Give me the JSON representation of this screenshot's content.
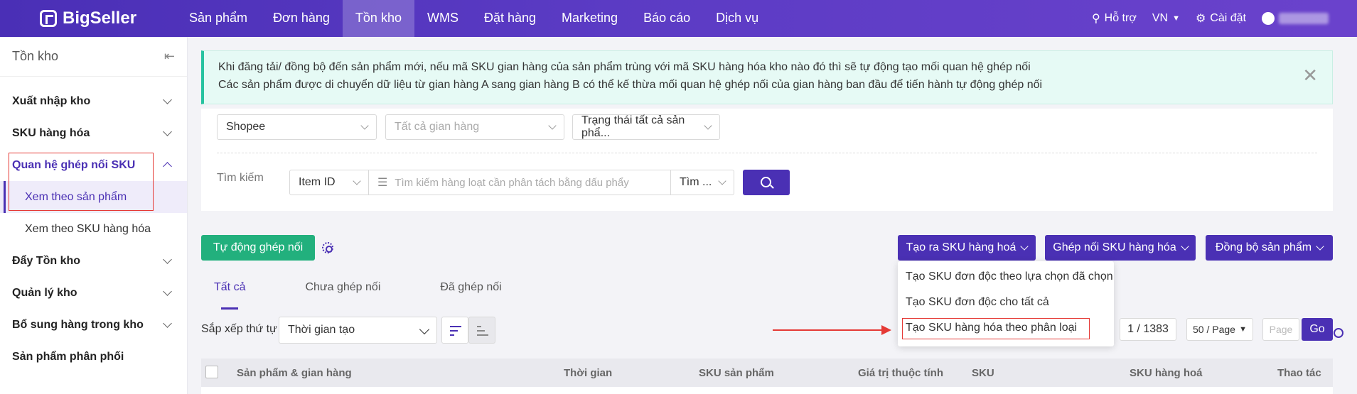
{
  "brand": {
    "name": "BigSeller"
  },
  "nav": {
    "items": [
      "Sản phẩm",
      "Đơn hàng",
      "Tồn kho",
      "WMS",
      "Đặt hàng",
      "Marketing",
      "Báo cáo",
      "Dịch vụ"
    ],
    "active": "Tồn kho"
  },
  "top_right": {
    "help": "Hỗ trợ",
    "lang": "VN",
    "settings": "Cài đặt"
  },
  "sidebar": {
    "title": "Tồn kho",
    "items": [
      {
        "label": "Xuất nhập kho"
      },
      {
        "label": "SKU hàng hóa"
      },
      {
        "label": "Quan hệ ghép nối SKU",
        "sub": [
          "Xem theo sản phẩm",
          "Xem theo SKU hàng hóa"
        ]
      },
      {
        "label": "Đẩy Tồn kho"
      },
      {
        "label": "Quản lý kho"
      },
      {
        "label": "Bổ sung hàng trong kho"
      },
      {
        "label": "Sản phẩm phân phối"
      }
    ]
  },
  "alert": {
    "line1": "Khi đăng tải/ đồng bộ đến sản phẩm mới, nếu mã SKU gian hàng của sản phẩm trùng với mã SKU hàng hóa kho nào đó thì sẽ tự động tạo mối quan hệ ghép nối",
    "line2": "Các sản phẩm được di chuyển dữ liệu từ gian hàng A sang gian hàng B có thể kế thừa mối quan hệ ghép nối của gian hàng ban đầu để tiến hành tự động ghép nối"
  },
  "filters": {
    "platform": "Shopee",
    "store_placeholder": "Tất cả gian hàng",
    "status": "Trạng thái tất cả sản phẩ...",
    "search_label": "Tìm kiếm",
    "search_type": "Item ID",
    "search_placeholder": "Tìm kiếm hàng loạt cần phân tách bằng dấu phẩy",
    "search_mode": "Tìm ..."
  },
  "actions": {
    "auto_match": "Tự động ghép nối",
    "create_sku": "Tạo ra SKU hàng hoá",
    "match_sku": "Ghép nối SKU hàng hóa",
    "sync_products": "Đồng bộ sản phẩm"
  },
  "dropdown": {
    "items": [
      "Tạo SKU đơn độc theo lựa chọn đã chọn",
      "Tạo SKU đơn độc cho tất cả",
      "Tạo SKU hàng hóa theo phân loại"
    ]
  },
  "tabs": [
    "Tất cả",
    "Chưa ghép nối",
    "Đã ghép nối"
  ],
  "sort": {
    "label": "Sắp xếp thứ tự",
    "value": "Thời gian tạo"
  },
  "pager": {
    "page": "1 / 1383",
    "per_page": "50 / Page",
    "page_placeholder": "Page",
    "go": "Go"
  },
  "table": {
    "columns": [
      "Sản phẩm & gian hàng",
      "Thời gian",
      "SKU sản phẩm",
      "Giá trị thuộc tính",
      "SKU",
      "SKU hàng hoá",
      "Thao tác"
    ]
  },
  "colors": {
    "brand": "#4a30b4",
    "green": "#22b07d",
    "highlight": "#e53935"
  }
}
